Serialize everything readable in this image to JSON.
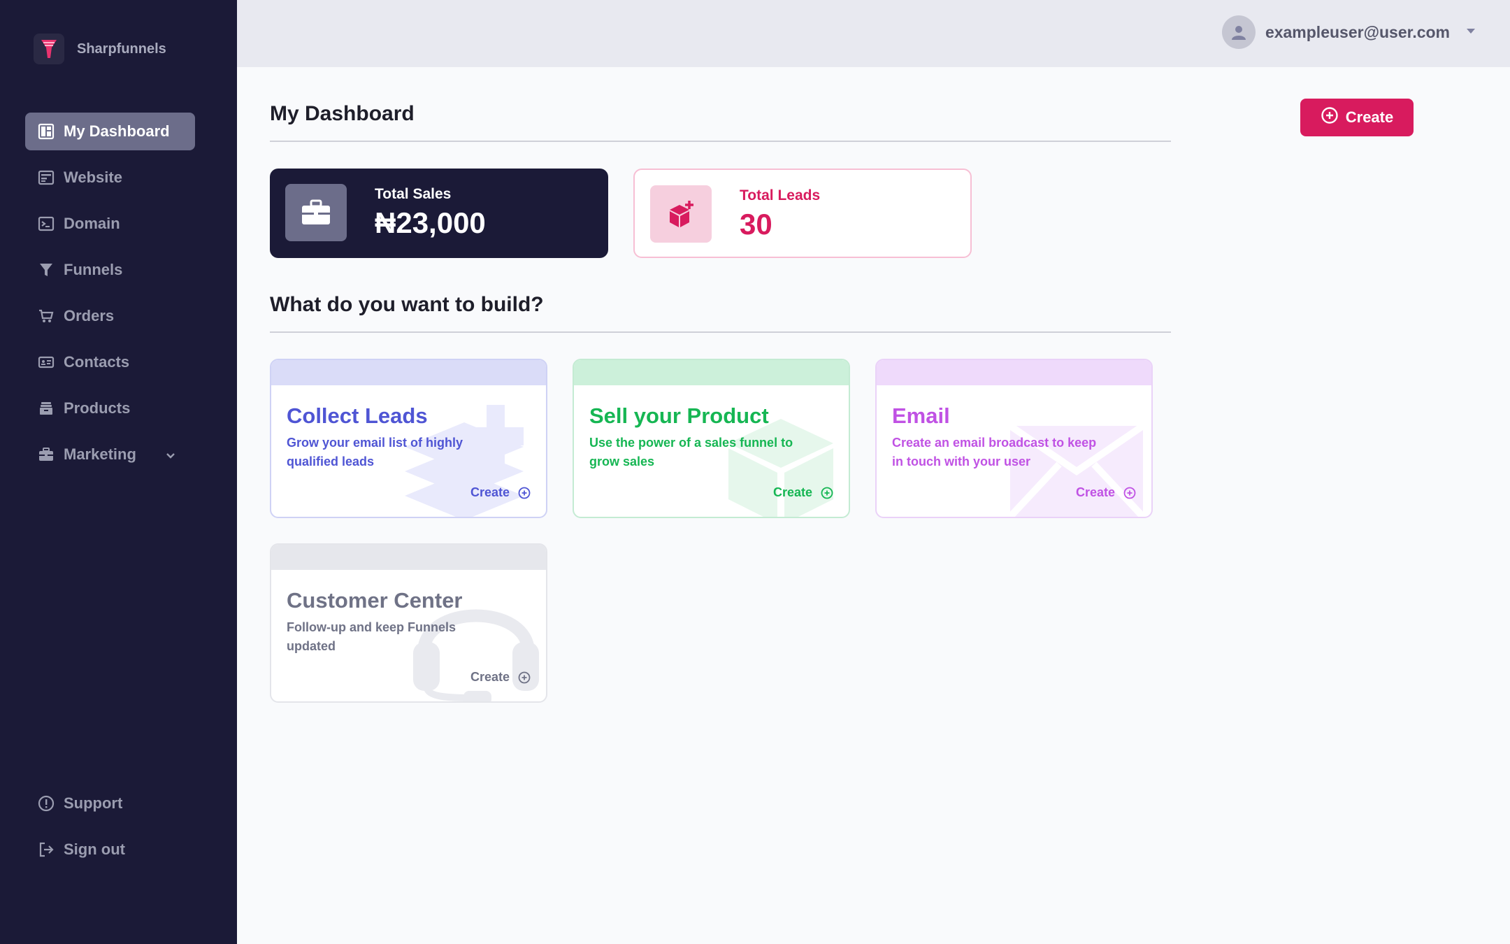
{
  "brand": {
    "name": "Sharpfunnels"
  },
  "sidebar": {
    "items": [
      {
        "label": "My Dashboard",
        "icon": "dashboard-icon",
        "active": true
      },
      {
        "label": "Website",
        "icon": "website-icon"
      },
      {
        "label": "Domain",
        "icon": "terminal-icon"
      },
      {
        "label": "Funnels",
        "icon": "funnel-icon"
      },
      {
        "label": "Orders",
        "icon": "cart-icon"
      },
      {
        "label": "Contacts",
        "icon": "id-card-icon"
      },
      {
        "label": "Products",
        "icon": "box-icon"
      },
      {
        "label": "Marketing",
        "icon": "briefcase-icon",
        "has_dropdown": true
      }
    ],
    "bottom": [
      {
        "label": "Support",
        "icon": "alert-circle-icon"
      },
      {
        "label": "Sign out",
        "icon": "sign-out-icon"
      }
    ]
  },
  "header": {
    "user_email": "exampleuser@user.com"
  },
  "main": {
    "title": "My Dashboard",
    "create_label": "Create",
    "stats": {
      "sales": {
        "label": "Total Sales",
        "value": "₦23,000"
      },
      "leads": {
        "label": "Total Leads",
        "value": "30"
      }
    },
    "build_title": "What do you want to build?",
    "cards": [
      {
        "title": "Collect Leads",
        "desc": "Grow your email list of highly qualified leads",
        "action": "Create"
      },
      {
        "title": "Sell your Product",
        "desc": "Use the power of a sales funnel to grow sales",
        "action": "Create"
      },
      {
        "title": "Email",
        "desc": "Create an email broadcast to keep in touch with your user",
        "action": "Create"
      },
      {
        "title": "Customer Center",
        "desc": "Follow-up and keep  Funnels updated",
        "action": "Create"
      }
    ]
  },
  "colors": {
    "sidebar_bg": "#1b1a37",
    "accent": "#d81b5e",
    "leads_blue": "#4f55d4",
    "product_green": "#16b653",
    "email_purple": "#c052e4",
    "customer_gray": "#6f7286"
  }
}
